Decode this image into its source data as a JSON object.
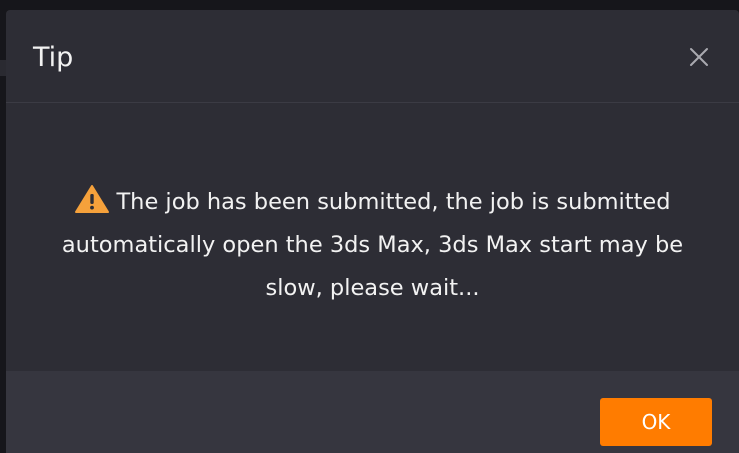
{
  "dialog": {
    "title": "Tip",
    "message": "The job has been submitted, the job is submitted automatically open the 3ds Max, 3ds Max start may be slow, please wait...",
    "message_icon": "warning-icon",
    "close_icon": "close-icon",
    "ok_label": "OK"
  },
  "colors": {
    "dialog_background": "#2d2d35",
    "footer_background": "#36363f",
    "accent": "#ff7c00",
    "warning": "#f5a13b",
    "text": "#f2f2f2"
  }
}
